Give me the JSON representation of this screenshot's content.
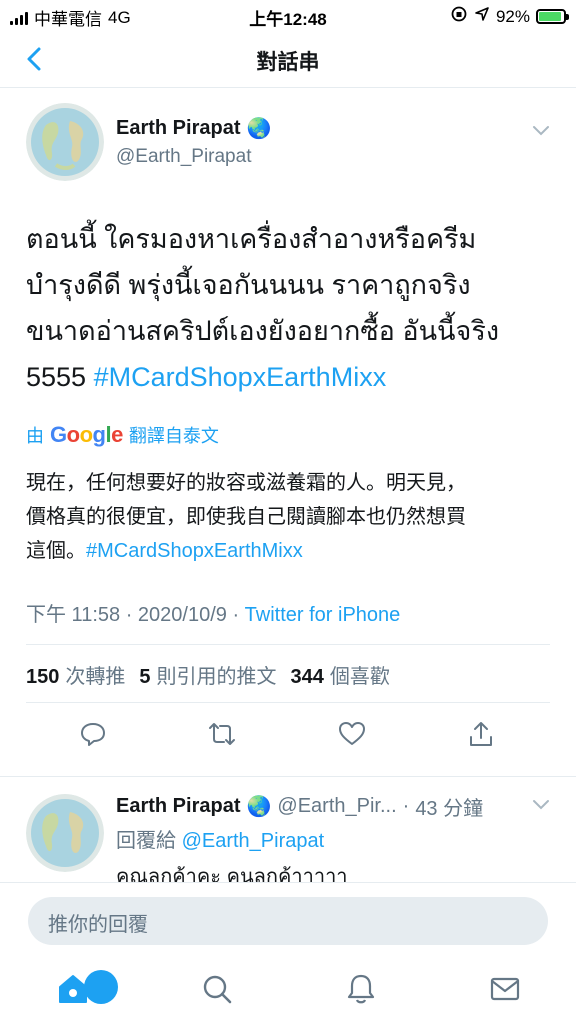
{
  "status_bar": {
    "carrier": "中華電信",
    "network": "4G",
    "time": "上午12:48",
    "battery": "92%",
    "battery_level": 0.92
  },
  "header": {
    "title": "對話串"
  },
  "tweet": {
    "author_name": "Earth Pirapat",
    "author_emoji": "🌏",
    "author_handle": "@Earth_Pirapat",
    "text_lines": [
      "ตอนนี้ ใครมองหาเครื่องสำอางหรือครีม",
      "บำรุงดีดี พรุ่งนี้เจอกันนนน ราคาถูกจริง",
      "ขนาดอ่านสคริปต์เองยังอยากซื้อ อันนี้จริง"
    ],
    "text_last_prefix": "5555 ",
    "hashtag": "#MCardShopxEarthMixx",
    "translate_by": "由",
    "translate_google": "Google",
    "translate_label": "翻譯自泰文",
    "translated_lines": [
      "現在，任何想要好的妝容或滋養霜的人。明天見，",
      "價格真的很便宜，即使我自己閱讀腳本也仍然想買",
      "這個。"
    ],
    "translated_hashtag": "#MCardShopxEarthMixx",
    "time": "下午 11:58",
    "date": "2020/10/9",
    "source": "Twitter for iPhone",
    "retweets": "150",
    "retweets_label": "次轉推",
    "quotes": "5",
    "quotes_label": "則引用的推文",
    "likes": "344",
    "likes_label": "個喜歡"
  },
  "reply": {
    "author_name": "Earth Pirapat",
    "author_emoji": "🌏",
    "author_handle": "@Earth_Pir...",
    "time": "43 分鐘",
    "reply_to_label": "回覆給",
    "reply_to_handle": "@Earth_Pirapat",
    "text": "คุณลูกค้าคะ คุนลูกค้าาาาา"
  },
  "composer": {
    "placeholder": "推你的回覆"
  },
  "colors": {
    "accent": "#1da1f2",
    "secondary_text": "#657786",
    "divider": "#e6ecf0",
    "battery_fill": "#4cd964"
  },
  "icons": {
    "back": "chevron-left-icon",
    "reply": "reply-icon",
    "retweet": "retweet-icon",
    "like": "heart-icon",
    "share": "share-icon",
    "home": "home-icon",
    "search": "search-icon",
    "notifications": "bell-icon",
    "messages": "mail-icon"
  }
}
